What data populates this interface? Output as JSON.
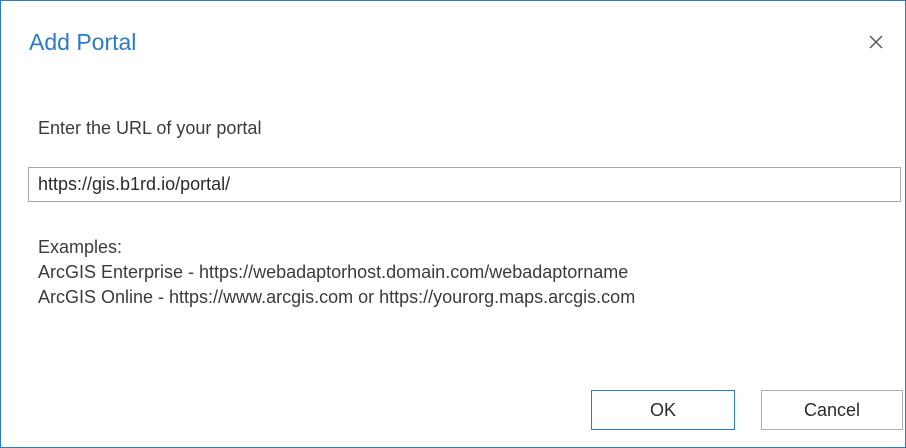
{
  "dialog": {
    "title": "Add Portal",
    "close_icon": "close-icon",
    "prompt": "Enter the URL of your portal",
    "url_value": "https://gis.b1rd.io/portal/",
    "examples": {
      "heading": "Examples:",
      "enterprise": "ArcGIS Enterprise - https://webadaptorhost.domain.com/webadaptorname",
      "online": "ArcGIS Online - https://www.arcgis.com or https://yourorg.maps.arcgis.com"
    },
    "buttons": {
      "ok_label": "OK",
      "cancel_label": "Cancel"
    }
  },
  "colors": {
    "accent": "#2a7cc4",
    "text": "#3b3b3b",
    "border": "#adadad"
  }
}
